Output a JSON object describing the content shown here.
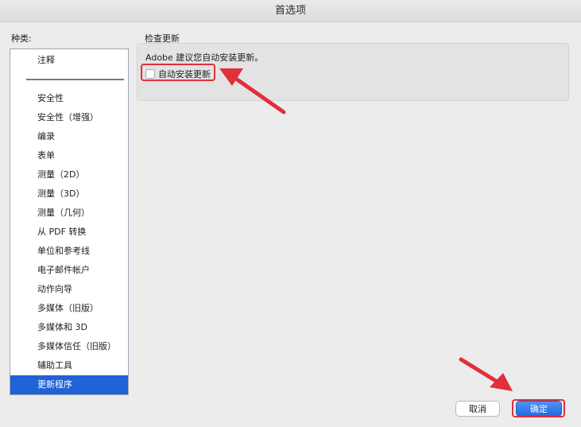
{
  "window": {
    "title": "首选项"
  },
  "sidebar": {
    "label": "种类:",
    "items": [
      {
        "label": "注释",
        "selected": false
      },
      {
        "label": "安全性",
        "selected": false
      },
      {
        "label": "安全性（增强）",
        "selected": false
      },
      {
        "label": "编录",
        "selected": false
      },
      {
        "label": "表单",
        "selected": false
      },
      {
        "label": "测量（2D）",
        "selected": false
      },
      {
        "label": "测量（3D）",
        "selected": false
      },
      {
        "label": "测量（几何）",
        "selected": false
      },
      {
        "label": "从 PDF 转换",
        "selected": false
      },
      {
        "label": "单位和参考线",
        "selected": false
      },
      {
        "label": "电子邮件帐户",
        "selected": false
      },
      {
        "label": "动作向导",
        "selected": false
      },
      {
        "label": "多媒体（旧版）",
        "selected": false
      },
      {
        "label": "多媒体和 3D",
        "selected": false
      },
      {
        "label": "多媒体信任（旧版）",
        "selected": false
      },
      {
        "label": "辅助工具",
        "selected": false
      },
      {
        "label": "更新程序",
        "selected": true
      }
    ]
  },
  "main": {
    "section_title": "检查更新",
    "recommend_text": "Adobe 建议您自动安装更新。",
    "auto_install": {
      "label": "自动安装更新",
      "checked": false
    }
  },
  "footer": {
    "cancel_label": "取消",
    "ok_label": "确定"
  },
  "colors": {
    "selection": "#1f63d7",
    "annotation_red": "#e0303a",
    "primary_button": "#1f6ae3"
  }
}
